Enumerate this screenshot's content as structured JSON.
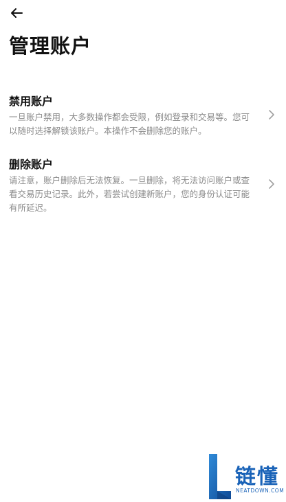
{
  "header": {
    "back_icon": "arrow-left-icon",
    "title": "管理账户"
  },
  "options": [
    {
      "title": "禁用账户",
      "description": "一旦账户禁用，大多数操作都会受限，例如登录和交易等。您可以随时选择解锁该账户。本操作不会删除您的账户。",
      "icon": "chevron-right-icon"
    },
    {
      "title": "删除账户",
      "description": "请注意，账户删除后无法恢复。一旦删除，将无法访问账户或查看交易历史记录。此外，若尝试创建新账户，您的身份认证可能有所延迟。",
      "icon": "chevron-right-icon"
    }
  ],
  "watermark": {
    "name": "链懂",
    "url": "NEATDOWN.COM",
    "color": "#1a63b8"
  },
  "colors": {
    "text_primary": "#111111",
    "text_secondary": "#8a8a8a",
    "chevron": "#a0a0a0"
  }
}
